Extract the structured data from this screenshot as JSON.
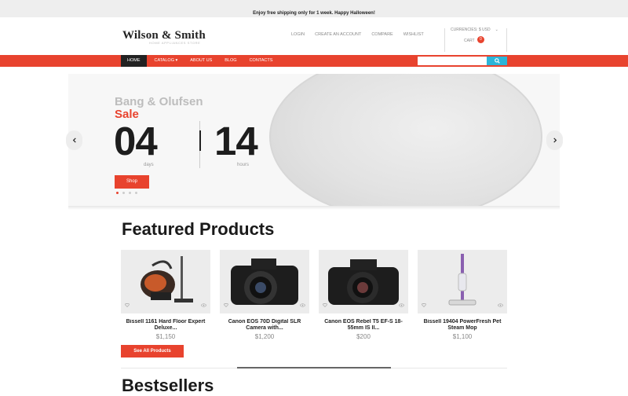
{
  "top_bar": {
    "message": "Enjoy free shipping only for 1 week. Happy Halloween!"
  },
  "header": {
    "logo": "Wilson & Smith",
    "tagline": "HOME APPLIANCES STORE",
    "links": [
      "LOGIN",
      "CREATE AN ACCOUNT",
      "COMPARE",
      "WISHLIST"
    ],
    "currency": "CURRENCIES: $ USD",
    "cart_label": "CART",
    "cart_count": "0"
  },
  "nav": {
    "items": [
      "HOME",
      "CATALOG",
      "ABOUT US",
      "BLOG",
      "CONTACTS"
    ],
    "search_placeholder": ""
  },
  "hero": {
    "brand": "Bang & Olufsen",
    "headline": "Sale",
    "days": "04",
    "hours": "14",
    "days_label": "days",
    "hours_label": "hours",
    "button": "Shop"
  },
  "featured": {
    "title": "Featured Products",
    "see_all": "See All Products",
    "products": [
      {
        "name": "Bissell 1161 Hard Floor Expert Deluxe...",
        "price": "$1,150"
      },
      {
        "name": "Canon EOS 70D Digital SLR Camera with...",
        "price": "$1,200"
      },
      {
        "name": "Canon EOS Rebel T5 EF-S 18-55mm IS II...",
        "price": "$200"
      },
      {
        "name": "Bissell 19404 PowerFresh Pet Steam Mop",
        "price": "$1,100"
      }
    ]
  },
  "bestsellers": {
    "title": "Bestsellers"
  },
  "colors": {
    "accent": "#e8432e",
    "search_button": "#2bb5d9",
    "nav_active": "#222222"
  }
}
